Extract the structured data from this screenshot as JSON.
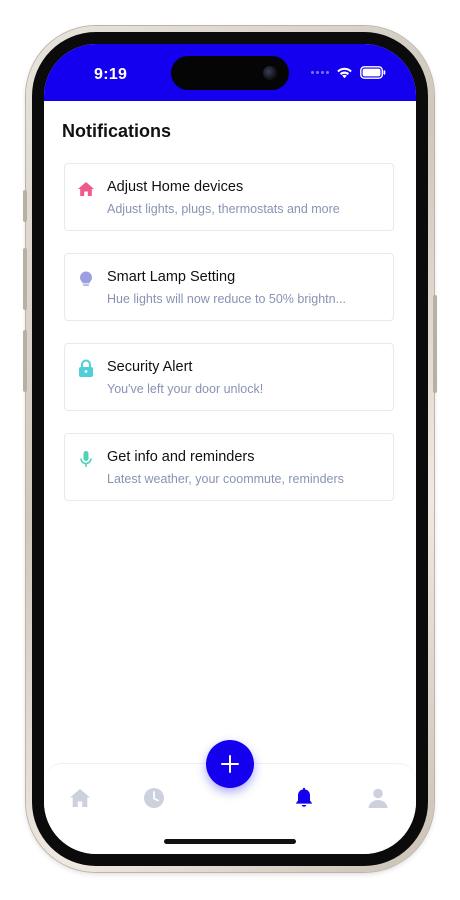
{
  "status_bar": {
    "time": "9:19",
    "background_color": "#1400ef"
  },
  "page": {
    "title": "Notifications"
  },
  "notifications": [
    {
      "icon": "home-icon",
      "icon_color": "#ef5a8a",
      "title": "Adjust Home devices",
      "subtitle": "Adjust lights, plugs, thermostats and more"
    },
    {
      "icon": "lightbulb-icon",
      "icon_color": "#9b9ee0",
      "title": "Smart Lamp Setting",
      "subtitle": "Hue lights will now reduce to 50% brightn..."
    },
    {
      "icon": "lock-icon",
      "icon_color": "#4fcfd6",
      "title": "Security Alert",
      "subtitle": "You've left your door unlock!"
    },
    {
      "icon": "microphone-icon",
      "icon_color": "#4fd3b5",
      "title": "Get info and reminders",
      "subtitle": "Latest weather, your coommute, reminders"
    }
  ],
  "tab_bar": {
    "tabs": [
      {
        "icon": "home-icon",
        "active": false
      },
      {
        "icon": "clock-icon",
        "active": false
      },
      {
        "icon": "bell-icon",
        "active": true
      },
      {
        "icon": "user-icon",
        "active": false
      }
    ],
    "fab_icon": "plus-icon",
    "accent_color": "#1400ef",
    "inactive_color": "#cdd1de"
  }
}
